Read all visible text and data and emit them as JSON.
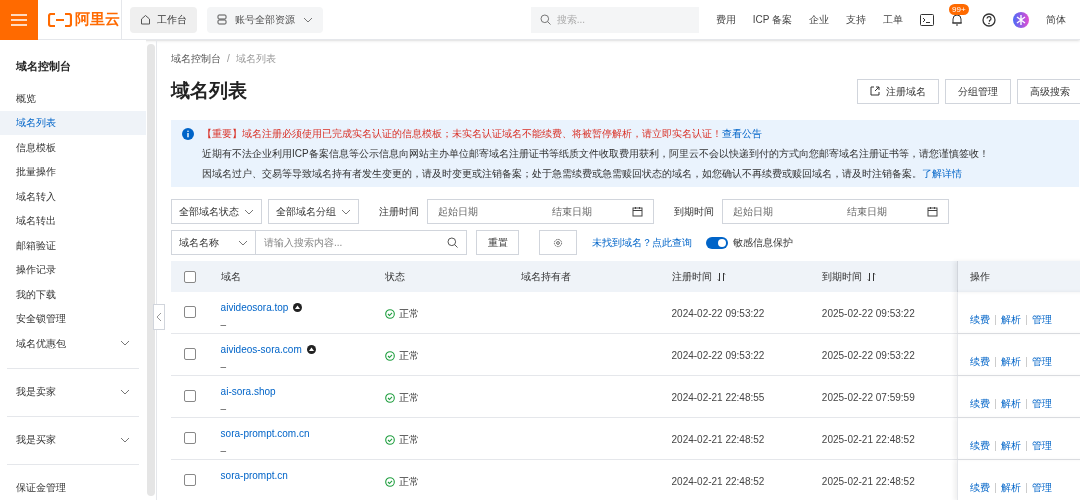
{
  "topbar": {
    "logo": "阿里云",
    "workbench": "工作台",
    "resources": "账号全部资源",
    "search_placeholder": "搜索...",
    "menu": [
      "费用",
      "ICP 备案",
      "企业",
      "支持",
      "工单"
    ],
    "badge": "99+",
    "language": "简体"
  },
  "sidebar": {
    "title": "域名控制台",
    "items": [
      {
        "label": "概览",
        "selected": false
      },
      {
        "label": "域名列表",
        "selected": true
      },
      {
        "label": "信息模板",
        "selected": false
      },
      {
        "label": "批量操作",
        "selected": false
      },
      {
        "label": "域名转入",
        "selected": false
      },
      {
        "label": "域名转出",
        "selected": false
      },
      {
        "label": "邮箱验证",
        "selected": false
      },
      {
        "label": "操作记录",
        "selected": false
      },
      {
        "label": "我的下载",
        "selected": false
      },
      {
        "label": "安全锁管理",
        "selected": false
      },
      {
        "label": "域名优惠包",
        "selected": false,
        "expanded": false
      }
    ],
    "groups": [
      {
        "label": "我是卖家",
        "expanded": false
      },
      {
        "label": "我是买家",
        "expanded": false
      }
    ],
    "footer_item": "保证金管理"
  },
  "breadcrumb": [
    "域名控制台",
    "域名列表"
  ],
  "breadcrumb_separator": "/",
  "page_title": "域名列表",
  "actions": [
    {
      "label": "注册域名",
      "kind": "external"
    },
    {
      "label": "分组管理",
      "kind": "plain"
    },
    {
      "label": "高级搜索",
      "kind": "plain"
    }
  ],
  "notice": {
    "important": "【重要】域名注册必须使用已完成实名认证的信息模板；未实名认证域名不能续费、将被暂停解析，请立即实名认证！",
    "important_link": "查看公告",
    "line_2": "近期有不法企业利用ICP备案信息等公示信息向网站主办单位邮寄域名注册证书等纸质文件收取费用获利，阿里云不会以快递到付的方式向您邮寄域名注册证书等，请您谨慎签收！",
    "line_3": "因域名过户、交易等导致域名持有者发生变更的，请及时变更或注销备案；处于急需续费或急需赎回状态的域名，如您确认不再续费或赎回域名，请及时注销备案。",
    "line_3_link": "了解详情"
  },
  "filters": {
    "status_select": "全部域名状态",
    "group_select": "全部域名分组",
    "reg_label": "注册时间",
    "reg_start_placeholder": "起始日期",
    "reg_end_placeholder": "结束日期",
    "exp_label": "到期时间",
    "exp_start_placeholder": "起始日期",
    "exp_end_placeholder": "结束日期",
    "field_select": "域名名称",
    "search_placeholder": "请输入搜索内容...",
    "reset": "重置",
    "not_found_link": "未找到域名？点此查询",
    "privacy": {
      "label": "敏感信息保护",
      "on": true
    }
  },
  "table": {
    "select_all_checked": false,
    "columns": [
      {
        "label": "域名",
        "sortable": false
      },
      {
        "label": "状态",
        "sortable": false
      },
      {
        "label": "域名持有者",
        "sortable": false
      },
      {
        "label": "注册时间",
        "sortable": true
      },
      {
        "label": "到期时间",
        "sortable": true
      },
      {
        "label": "操作",
        "sortable": false
      }
    ],
    "rows": [
      {
        "checked": false,
        "domain": "aivideosora.top",
        "flag": true,
        "note": "–",
        "status": "正常",
        "registered": "2024-02-22 09:53:22",
        "expires": "2025-02-22 09:53:22",
        "ops": [
          "续费",
          "解析",
          "管理"
        ]
      },
      {
        "checked": false,
        "domain": "aivideos-sora.com",
        "flag": true,
        "note": "–",
        "status": "正常",
        "registered": "2024-02-22 09:53:22",
        "expires": "2025-02-22 09:53:22",
        "ops": [
          "续费",
          "解析",
          "管理"
        ]
      },
      {
        "checked": false,
        "domain": "ai-sora.shop",
        "flag": false,
        "note": "–",
        "status": "正常",
        "registered": "2024-02-21 22:48:55",
        "expires": "2025-02-22 07:59:59",
        "ops": [
          "续费",
          "解析",
          "管理"
        ]
      },
      {
        "checked": false,
        "domain": "sora-prompt.com.cn",
        "flag": false,
        "note": "–",
        "status": "正常",
        "registered": "2024-02-21 22:48:52",
        "expires": "2025-02-21 22:48:52",
        "ops": [
          "续费",
          "解析",
          "管理"
        ]
      },
      {
        "checked": false,
        "domain": "sora-prompt.cn",
        "flag": false,
        "note": "",
        "status": "正常",
        "registered": "2024-02-21 22:48:52",
        "expires": "2025-02-21 22:48:52",
        "ops": [
          "续费",
          "解析",
          "管理"
        ]
      }
    ]
  }
}
